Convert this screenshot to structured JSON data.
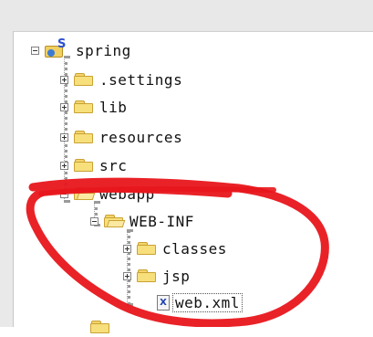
{
  "tree": {
    "project": "spring",
    "settings": ".settings",
    "lib": "lib",
    "resources": "resources",
    "src": "src",
    "webapp": "webapp",
    "web_inf": "WEB-INF",
    "classes": "classes",
    "jsp": "jsp",
    "web_xml": "web.xml"
  },
  "icons": {
    "project": "project-icon",
    "folder": "folder-icon",
    "xml_file": "xml-file-icon"
  },
  "colors": {
    "annotation": "#e8161c",
    "folder": "#f7df7c"
  }
}
